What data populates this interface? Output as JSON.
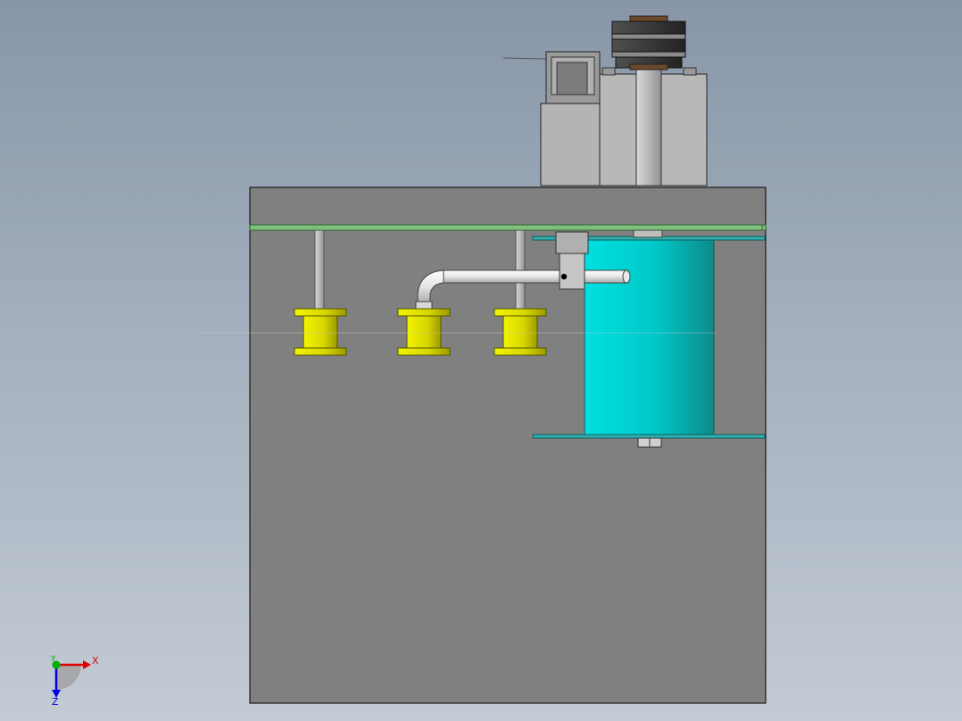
{
  "triad": {
    "x_label": "X",
    "y_label": "Y",
    "z_label": "Z"
  },
  "colors": {
    "background_top": "#8896a8",
    "background_bottom": "#c3cbd5",
    "housing": "#808080",
    "green_rail": "#7fbf7f",
    "tank": "#00c8c8",
    "tank_flange": "#30b0b0",
    "coil": "#d8d800",
    "pipe": "#e8e8e8",
    "triad_x": "#e00000",
    "triad_y": "#00b000",
    "triad_z": "#0000e0"
  }
}
